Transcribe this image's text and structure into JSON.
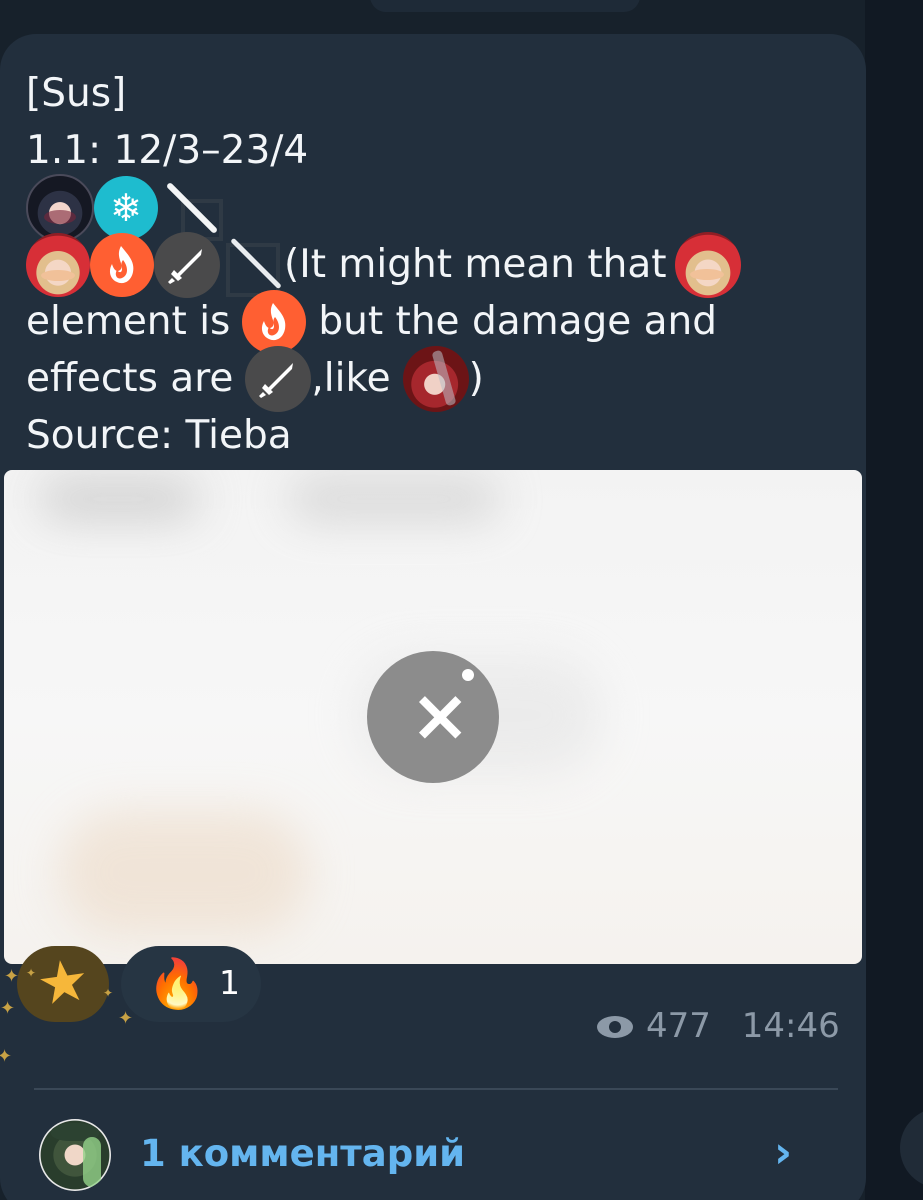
{
  "post": {
    "lines": [
      "[Sus]",
      "1.1: 12/3–23/4"
    ],
    "text_parts": {
      "line4_after_icons": "(It might mean that",
      "line5_start": "element is",
      "line5_end": "but the damage and",
      "line6_start": "effects are",
      "line6_end": ",like",
      "line6_close": ")",
      "source": "Source: Tieba"
    },
    "icons": {
      "character_dark": "character-avatar-icon",
      "ice": "ice-element-icon",
      "weapon_wand": "wand-weapon-icon",
      "character_red": "character-avatar-icon",
      "fire": "fire-element-icon",
      "sword": "sword-weapon-icon",
      "weapon_bow": "bow-weapon-icon",
      "character_crimson": "character-avatar-icon"
    },
    "media": {
      "close_icon": "close-icon"
    }
  },
  "reactions": [
    {
      "emoji": "star",
      "count": ""
    },
    {
      "emoji": "🔥",
      "count": "1"
    }
  ],
  "meta": {
    "views": "477",
    "time": "14:46"
  },
  "comments": {
    "label": "1 комментарий",
    "chevron": "›"
  },
  "colors": {
    "background": "#17212b",
    "bubble": "#222f3d",
    "text": "#f2f5f8",
    "link": "#64b5ef",
    "meta": "#8c99a7",
    "fire": "#ff5f32",
    "ice": "#1ebccf"
  }
}
